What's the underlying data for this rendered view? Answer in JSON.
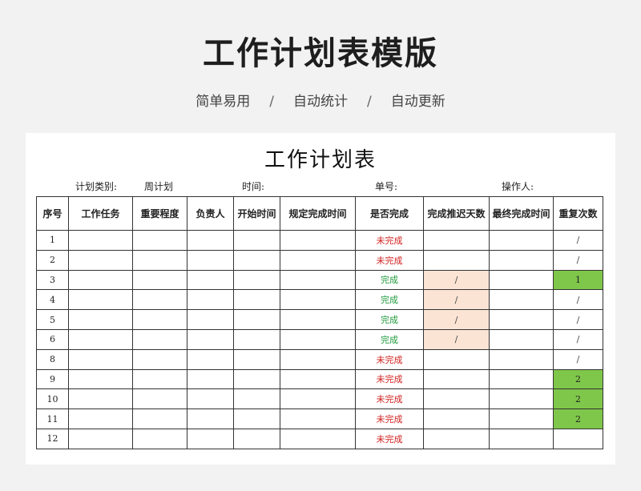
{
  "header": {
    "title": "工作计划表模版",
    "features": [
      "简单易用",
      "自动统计",
      "自动更新"
    ],
    "separator": "/"
  },
  "sheet": {
    "title": "工作计划表",
    "meta": {
      "type_label": "计划类别:",
      "type_value": "周计划",
      "time_label": "时间:",
      "order_label": "单号:",
      "operator_label": "操作人:"
    },
    "columns": [
      "序号",
      "工作任务",
      "重要程度",
      "负责人",
      "开始时间",
      "规定完成时间",
      "是否完成",
      "完成推迟天数",
      "最终完成时间",
      "重复次数"
    ],
    "rows": [
      {
        "no": "1",
        "status": "未完成",
        "delay": "",
        "repeat": "/"
      },
      {
        "no": "2",
        "status": "未完成",
        "delay": "",
        "repeat": "/"
      },
      {
        "no": "3",
        "status": "完成",
        "delay": "/",
        "repeat": "1"
      },
      {
        "no": "4",
        "status": "完成",
        "delay": "/",
        "repeat": "/"
      },
      {
        "no": "5",
        "status": "完成",
        "delay": "/",
        "repeat": "/"
      },
      {
        "no": "6",
        "status": "完成",
        "delay": "/",
        "repeat": "/"
      },
      {
        "no": "8",
        "status": "未完成",
        "delay": "",
        "repeat": "/"
      },
      {
        "no": "9",
        "status": "未完成",
        "delay": "",
        "repeat": "2"
      },
      {
        "no": "10",
        "status": "未完成",
        "delay": "",
        "repeat": "2"
      },
      {
        "no": "11",
        "status": "未完成",
        "delay": "",
        "repeat": "2"
      },
      {
        "no": "12",
        "status": "未完成",
        "delay": "",
        "repeat": ""
      }
    ],
    "colors": {
      "not_done": "#d0201f",
      "done": "#1f9a3b",
      "delay_fill": "#fbe4d4",
      "repeat_fill": "#7fc74a"
    }
  }
}
